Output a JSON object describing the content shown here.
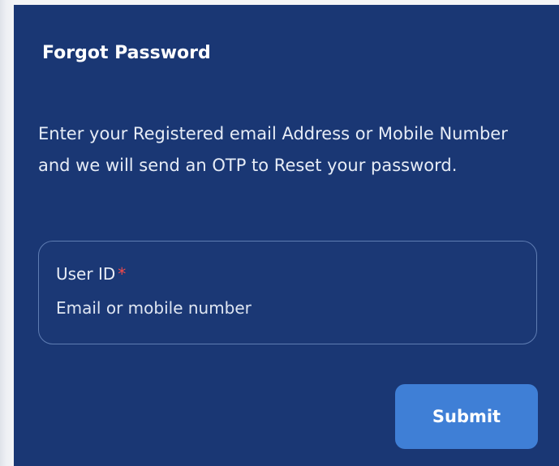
{
  "dialog": {
    "title": "Forgot Password",
    "description": "Enter your Registered email Address or Mobile Number and we will send an OTP to Reset your password."
  },
  "user_id_field": {
    "label": "User ID",
    "required_marker": "*",
    "value": "",
    "placeholder": "Email or mobile number"
  },
  "submit_button": {
    "label": "Submit"
  },
  "colors": {
    "panel_background": "#1a3774",
    "field_border": "#5f7db3",
    "button_background": "#3f7fd6",
    "required_marker": "#f24a4a",
    "text": "#ffffff"
  }
}
